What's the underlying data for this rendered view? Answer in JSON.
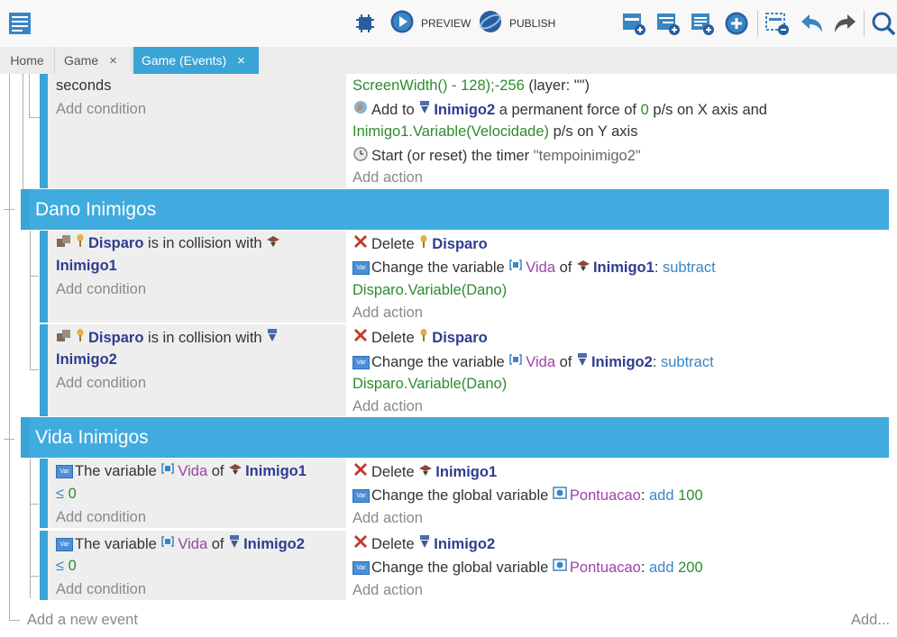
{
  "toolbar": {
    "preview_label": "PREVIEW",
    "publish_label": "PUBLISH"
  },
  "tabs": [
    {
      "label": "Home"
    },
    {
      "label": "Game",
      "close": "×"
    },
    {
      "label": "Game (Events)",
      "close": "×"
    }
  ],
  "event0": {
    "cond_line1": "seconds",
    "add_condition": "Add condition",
    "act1_expr": "ScreenWidth() - 128);-256",
    "act1_layer": "(layer: \"\")",
    "act2_addto": "Add to",
    "act2_obj": "Inimigo2",
    "act2_text1": "a permanent force of",
    "act2_zero": "0",
    "act2_text2": "p/s on X axis and",
    "act2_expr": "Inimigo1.Variable(Velocidade)",
    "act2_text3": "p/s on Y axis",
    "act3_text": "Start (or reset) the timer",
    "act3_timer": "\"tempoinimigo2\"",
    "add_action": "Add action"
  },
  "group1": {
    "title": "Dano Inimigos"
  },
  "event1": {
    "cond_obj": "Disparo",
    "cond_text": "is in collision with",
    "cond_obj2": "Inimigo1",
    "add_condition": "Add condition",
    "del_text": "Delete",
    "del_obj": "Disparo",
    "chg_text": "Change the variable",
    "chg_var": "Vida",
    "chg_of": "of",
    "chg_obj": "Inimigo1",
    "chg_colon": ":",
    "chg_op": "subtract",
    "chg_expr": "Disparo.Variable(Dano)",
    "add_action": "Add action"
  },
  "event2": {
    "cond_obj": "Disparo",
    "cond_text": "is in collision with",
    "cond_obj2": "Inimigo2",
    "add_condition": "Add condition",
    "del_text": "Delete",
    "del_obj": "Disparo",
    "chg_text": "Change the variable",
    "chg_var": "Vida",
    "chg_of": "of",
    "chg_obj": "Inimigo2",
    "chg_colon": ":",
    "chg_op": "subtract",
    "chg_expr": "Disparo.Variable(Dano)",
    "add_action": "Add action"
  },
  "group2": {
    "title": "Vida Inimigos"
  },
  "event3": {
    "cond_text": "The variable",
    "cond_var": "Vida",
    "cond_of": "of",
    "cond_obj": "Inimigo1",
    "cond_op": "≤",
    "cond_val": "0",
    "add_condition": "Add condition",
    "del_text": "Delete",
    "del_obj": "Inimigo1",
    "chg_text": "Change the global variable",
    "chg_var": "Pontuacao",
    "chg_colon": ":",
    "chg_op": "add",
    "chg_val": "100",
    "add_action": "Add action"
  },
  "event4": {
    "cond_text": "The variable",
    "cond_var": "Vida",
    "cond_of": "of",
    "cond_obj": "Inimigo2",
    "cond_op": "≤",
    "cond_val": "0",
    "add_condition": "Add condition",
    "del_text": "Delete",
    "del_obj": "Inimigo2",
    "chg_text": "Change the global variable",
    "chg_var": "Pontuacao",
    "chg_colon": ":",
    "chg_op": "add",
    "chg_val": "200",
    "add_action": "Add action"
  },
  "footer": {
    "add_event": "Add a new event",
    "add_more": "Add..."
  },
  "colors": {
    "accent": "#3aa4d6",
    "group": "#40abdf",
    "object": "#2f3c8f",
    "expression": "#2e8b2e",
    "variable": "#9b45a6",
    "operator": "#3a86c4"
  }
}
